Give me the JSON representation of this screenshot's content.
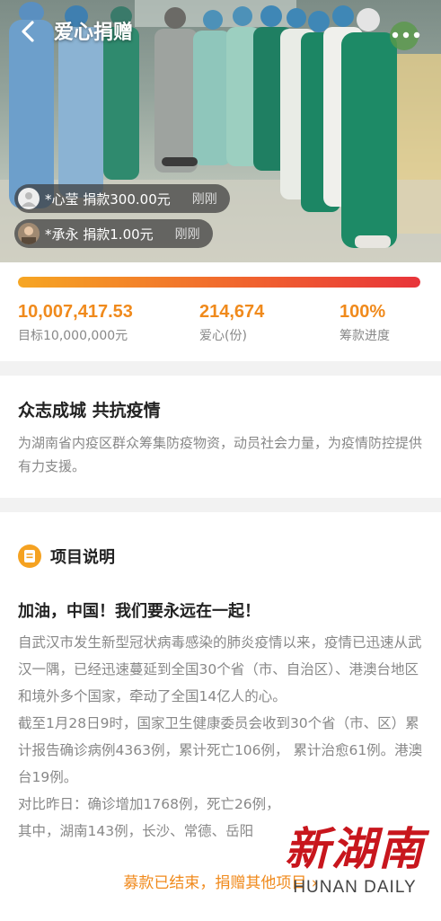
{
  "header": {
    "title": "爱心捐赠"
  },
  "donation_feed": [
    {
      "text": "*心莹 捐款300.00元",
      "when": "刚刚"
    },
    {
      "text": "*承永 捐款1.00元",
      "when": "刚刚"
    }
  ],
  "progress": {
    "fraction": 1.0,
    "raised": "10,007,417.53",
    "target_label": "目标10,000,000元",
    "donors": "214,674",
    "donors_label": "爱心(份)",
    "percent": "100%",
    "percent_label": "筹款进度"
  },
  "summary": {
    "title": "众志成城 共抗疫情",
    "desc": "为湖南省内疫区群众筹集防疫物资，动员社会力量，为疫情防控提供有力支援。"
  },
  "project": {
    "section_title": "项目说明",
    "headline": "加油，中国！我们要永远在一起！",
    "paragraphs": [
      "自武汉市发生新型冠状病毒感染的肺炎疫情以来，疫情已迅速从武汉一隅，已经迅速蔓延到全国30个省（市、自治区）、港澳台地区和境外多个国家，牵动了全国14亿人的心。",
      "截至1月28日9时，国家卫生健康委员会收到30个省（市、区）累计报告确诊病例4363例，累计死亡106例， 累计治愈61例。港澳台19例。",
      "对比昨日：确诊增加1768例，死亡26例，",
      "其中，湖南143例，长沙、常德、岳阳"
    ]
  },
  "footer": {
    "label": "募款已结束，捐赠其他项目 ›"
  },
  "watermark": {
    "cn": "新湖南",
    "en": "HUNAN DAILY"
  },
  "colors": {
    "accent": "#f08a1c",
    "brand_red": "#c8161d"
  }
}
